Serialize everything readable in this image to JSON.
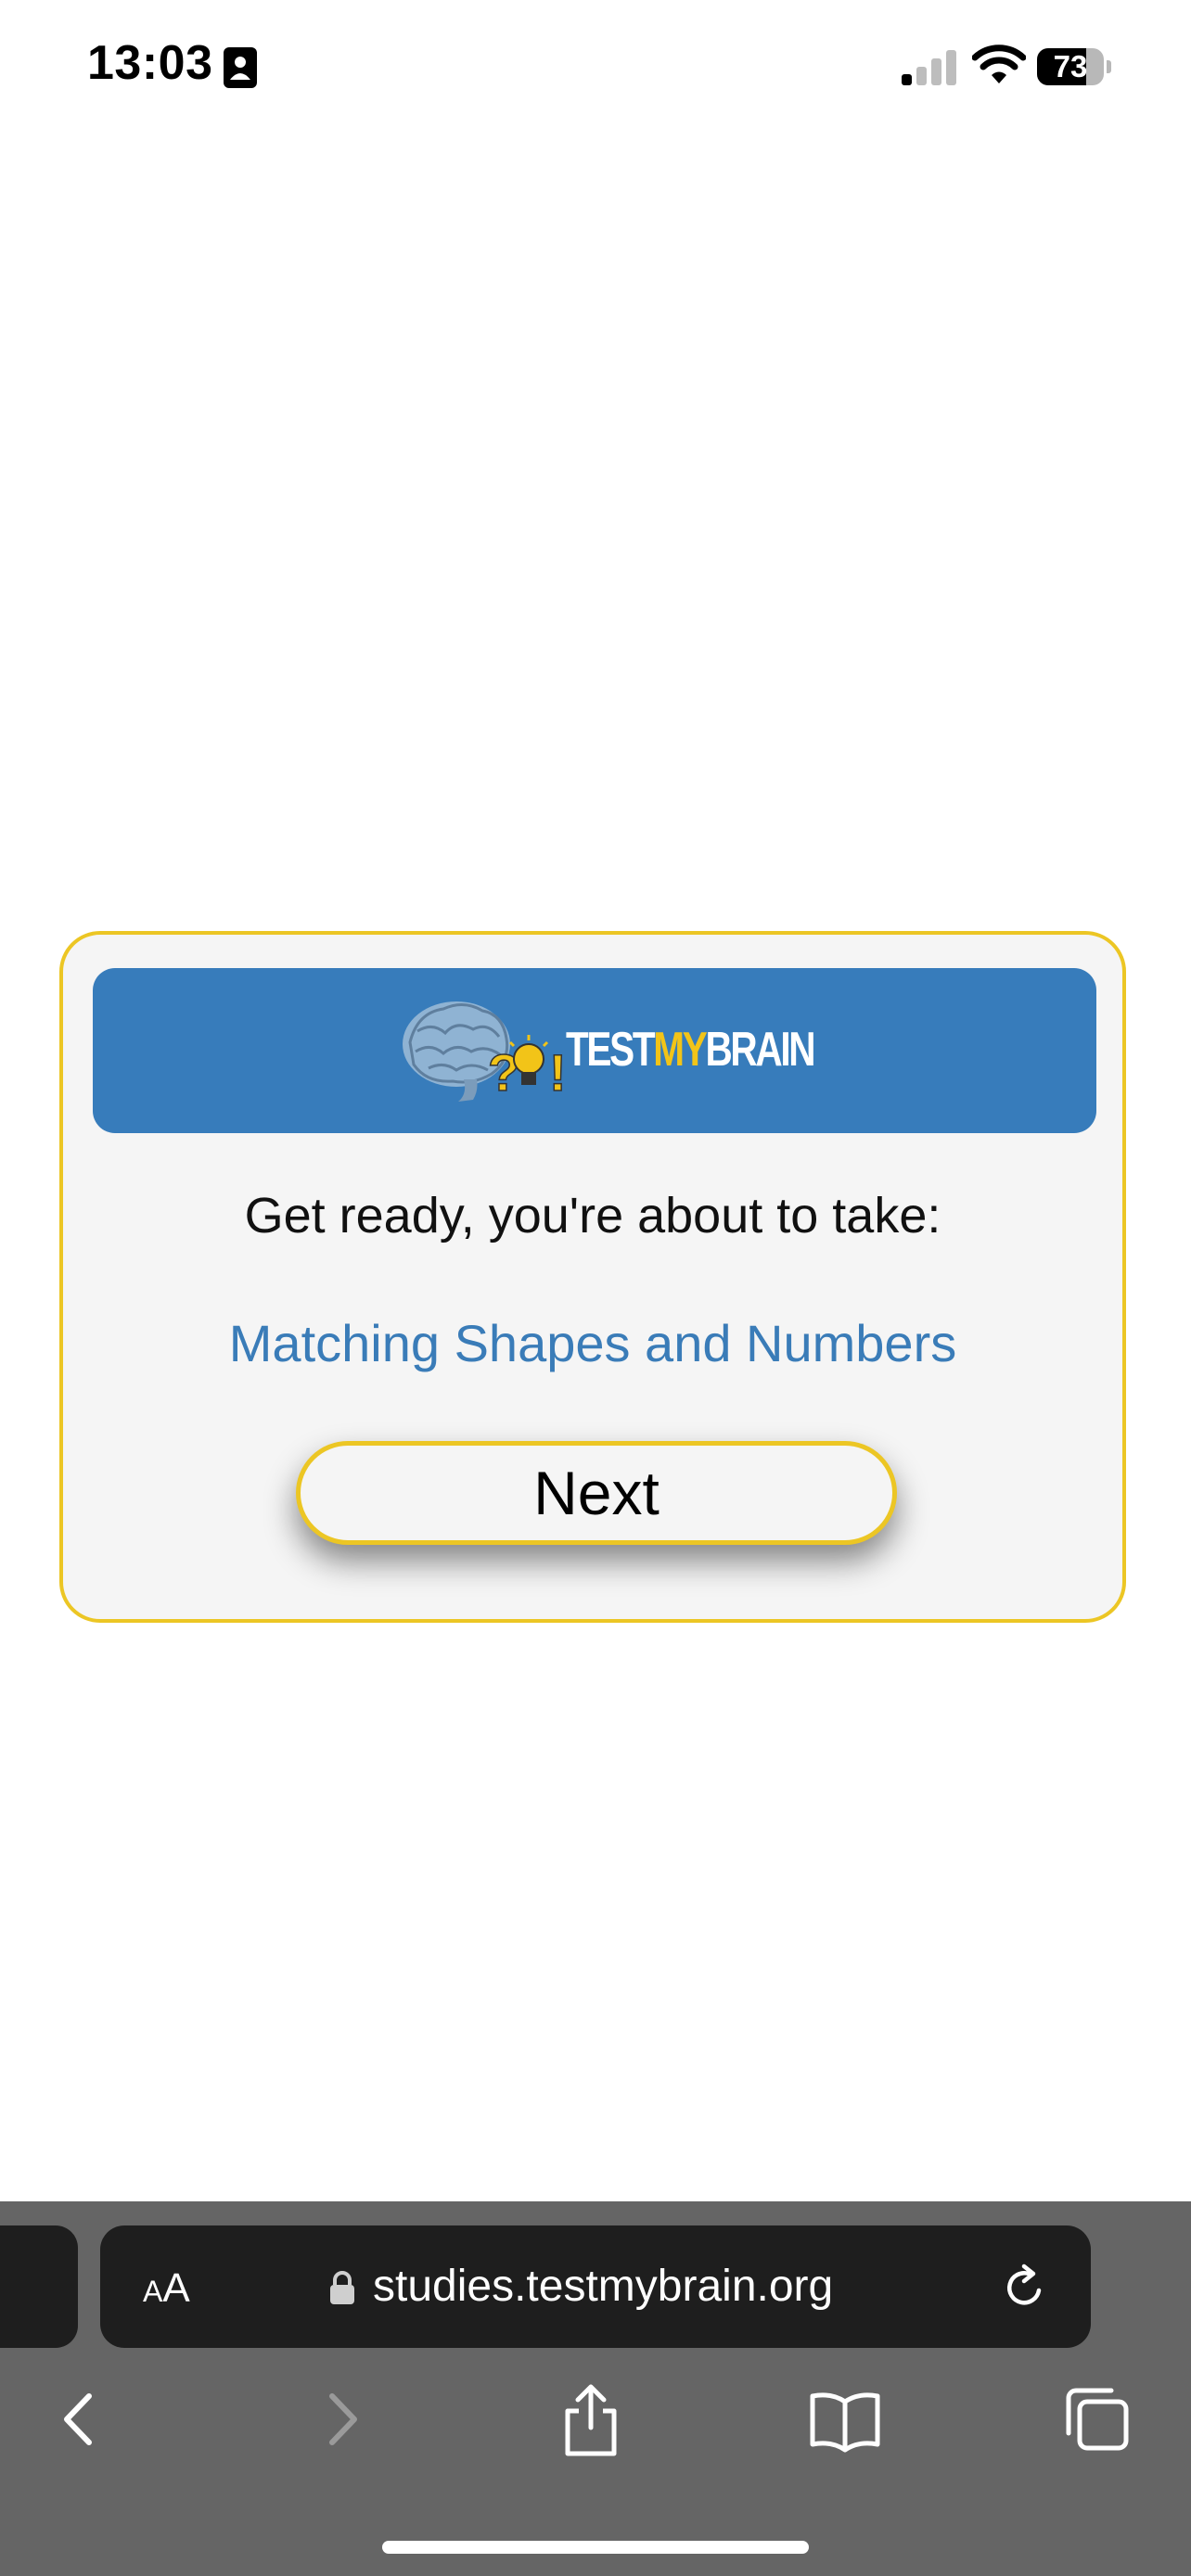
{
  "status_bar": {
    "time": "13:03",
    "battery_level": "73",
    "battery_fraction": 0.73,
    "icons": [
      "contact-card-icon",
      "cellular-signal-icon",
      "wifi-icon",
      "battery-icon"
    ]
  },
  "card": {
    "logo": {
      "wordmark_test": "TEST",
      "wordmark_my": "MY",
      "wordmark_brain": "BRAIN",
      "icons": [
        "brain-icon",
        "question-mark-icon",
        "lightbulb-icon",
        "exclamation-icon"
      ]
    },
    "intro_text": "Get ready, you're about to take:",
    "test_name": "Matching Shapes and Numbers",
    "next_label": "Next"
  },
  "browser": {
    "text_size_small": "A",
    "text_size_big": "A",
    "url": "studies.testmybrain.org",
    "toolbar_icons": [
      "back-icon",
      "forward-icon",
      "share-icon",
      "bookmarks-icon",
      "tabs-icon"
    ]
  },
  "colors": {
    "banner": "#377cbb",
    "card_border": "#ecc624",
    "link_blue": "#3a7cb8",
    "browser_chrome": "#656565",
    "address_bar": "#1e1e1e"
  }
}
